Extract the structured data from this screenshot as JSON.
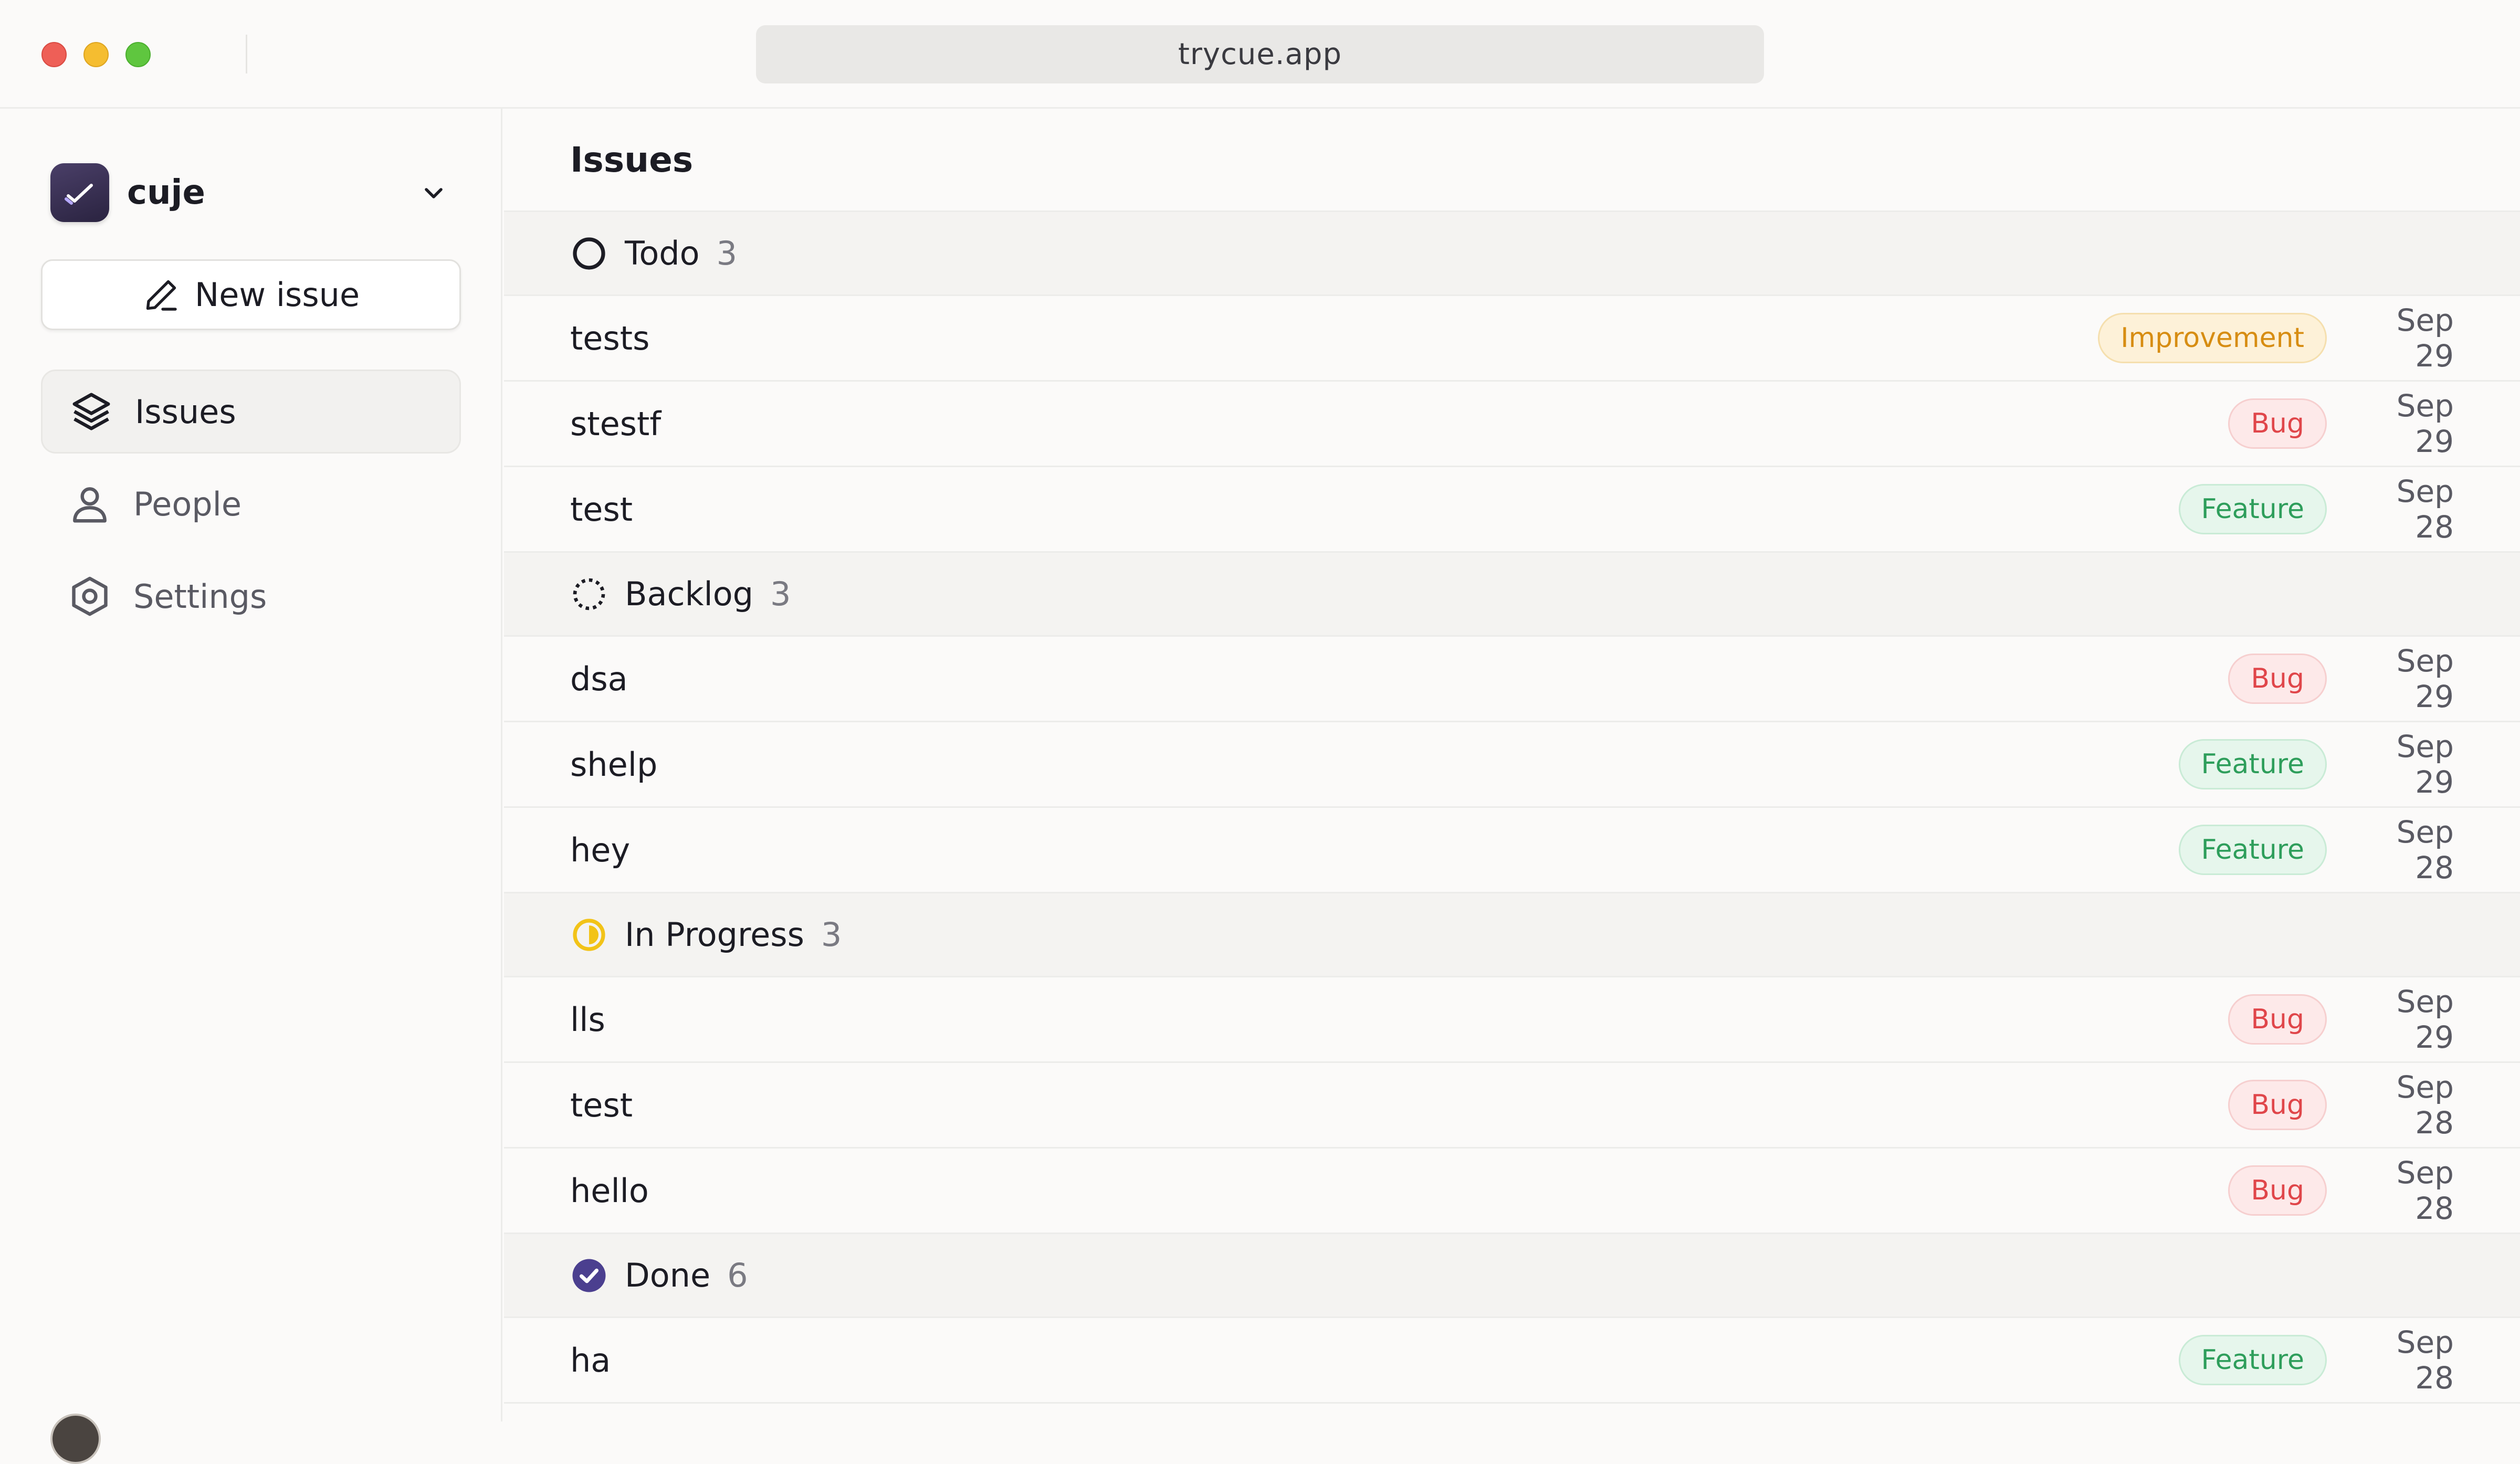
{
  "browser": {
    "url": "trycue.app"
  },
  "sidebar": {
    "workspace_name": "cuje",
    "new_issue_label": "New issue",
    "nav": [
      {
        "label": "Issues",
        "icon": "layers-icon",
        "active": true
      },
      {
        "label": "People",
        "icon": "person-icon",
        "active": false
      },
      {
        "label": "Settings",
        "icon": "gear-icon",
        "active": false
      }
    ]
  },
  "main": {
    "title": "Issues",
    "groups": [
      {
        "name": "Todo",
        "count": "3",
        "icon": "todo-circle-icon",
        "issues": [
          {
            "title": "tests",
            "tag": "Improvement",
            "tag_kind": "improvement",
            "date": "Sep 29"
          },
          {
            "title": "stestf",
            "tag": "Bug",
            "tag_kind": "bug",
            "date": "Sep 29"
          },
          {
            "title": "test",
            "tag": "Feature",
            "tag_kind": "feature",
            "date": "Sep 28"
          }
        ]
      },
      {
        "name": "Backlog",
        "count": "3",
        "icon": "backlog-dashed-circle-icon",
        "issues": [
          {
            "title": "dsa",
            "tag": "Bug",
            "tag_kind": "bug",
            "date": "Sep 29"
          },
          {
            "title": "shelp",
            "tag": "Feature",
            "tag_kind": "feature",
            "date": "Sep 29"
          },
          {
            "title": "hey",
            "tag": "Feature",
            "tag_kind": "feature",
            "date": "Sep 28"
          }
        ]
      },
      {
        "name": "In Progress",
        "count": "3",
        "icon": "in-progress-half-circle-icon",
        "issues": [
          {
            "title": "lls",
            "tag": "Bug",
            "tag_kind": "bug",
            "date": "Sep 29"
          },
          {
            "title": "test",
            "tag": "Bug",
            "tag_kind": "bug",
            "date": "Sep 28"
          },
          {
            "title": "hello",
            "tag": "Bug",
            "tag_kind": "bug",
            "date": "Sep 28"
          }
        ]
      },
      {
        "name": "Done",
        "count": "6",
        "icon": "done-check-circle-icon",
        "issues": [
          {
            "title": "ha",
            "tag": "Feature",
            "tag_kind": "feature",
            "date": "Sep 28"
          }
        ]
      }
    ]
  },
  "colors": {
    "accent": "#4b3f8f",
    "bug": "#e0464a",
    "feature": "#2e9e5b",
    "improvement": "#d78d12",
    "in_progress": "#f2c318"
  }
}
